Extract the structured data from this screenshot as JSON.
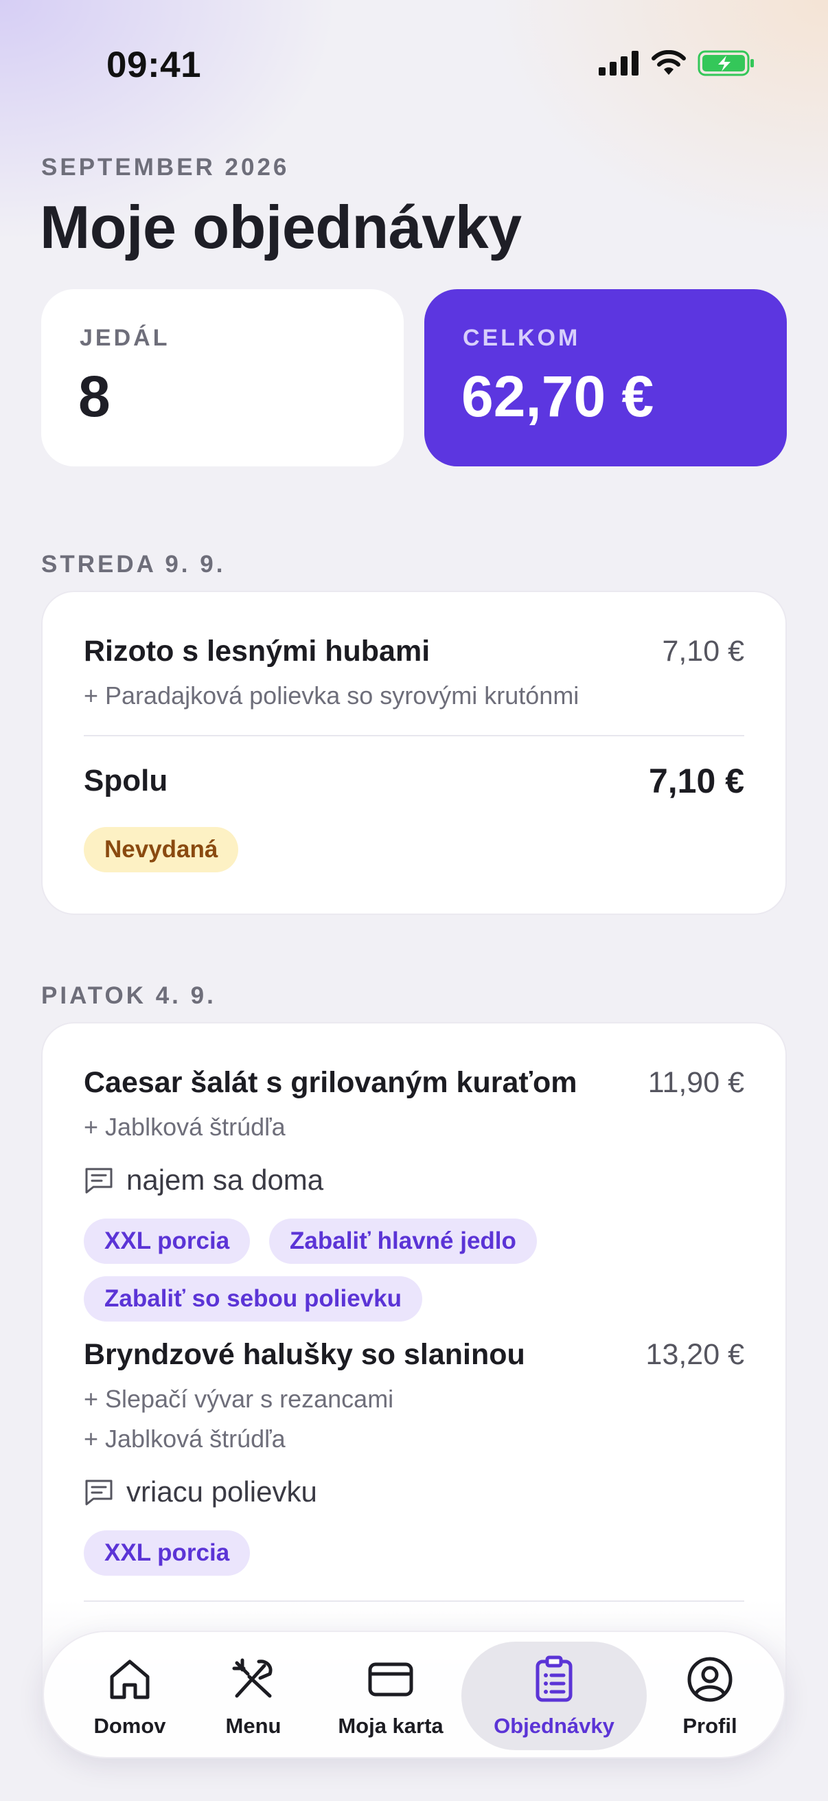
{
  "status_bar": {
    "time": "09:41"
  },
  "header": {
    "month": "SEPTEMBER 2026",
    "title": "Moje objednávky"
  },
  "stats": {
    "meals": {
      "label": "JEDÁL",
      "value": "8"
    },
    "total": {
      "label": "CELKOM",
      "value": "62,70 €"
    }
  },
  "days": [
    {
      "label": "STREDA 9. 9.",
      "items": [
        {
          "name": "Rizoto s lesnými hubami",
          "price": "7,10 €",
          "extras": [
            "+ Paradajková polievka so syrovými krutónmi"
          ]
        }
      ],
      "total_label": "Spolu",
      "total_value": "7,10 €",
      "status": "Nevydaná"
    },
    {
      "label": "PIATOK 4. 9.",
      "items": [
        {
          "name": "Caesar šalát s grilovaným kuraťom",
          "price": "11,90 €",
          "extras": [
            "+ Jablková štrúdľa"
          ],
          "note": "najem sa doma",
          "chips": [
            "XXL porcia",
            "Zabaliť hlavné jedlo",
            "Zabaliť so sebou polievku"
          ]
        },
        {
          "name": "Bryndzové halušky so slaninou",
          "price": "13,20 €",
          "extras": [
            "+ Slepačí vývar s rezancami",
            "+ Jablková štrúdľa"
          ],
          "note": "vriacu polievku",
          "chips": [
            "XXL porcia"
          ]
        }
      ]
    }
  ],
  "tabs": [
    {
      "label": "Domov",
      "icon": "home-icon",
      "active": false
    },
    {
      "label": "Menu",
      "icon": "fork-knife-icon",
      "active": false
    },
    {
      "label": "Moja karta",
      "icon": "card-icon",
      "active": false
    },
    {
      "label": "Objednávky",
      "icon": "clipboard-list-icon",
      "active": true
    },
    {
      "label": "Profil",
      "icon": "profile-icon",
      "active": false
    }
  ],
  "colors": {
    "accent": "#5c36e0",
    "chip_bg": "#ebe5fc",
    "chip_text": "#5b34d6",
    "badge_bg": "#fdf1c4",
    "badge_text": "#8a4a10",
    "battery": "#34c759"
  }
}
